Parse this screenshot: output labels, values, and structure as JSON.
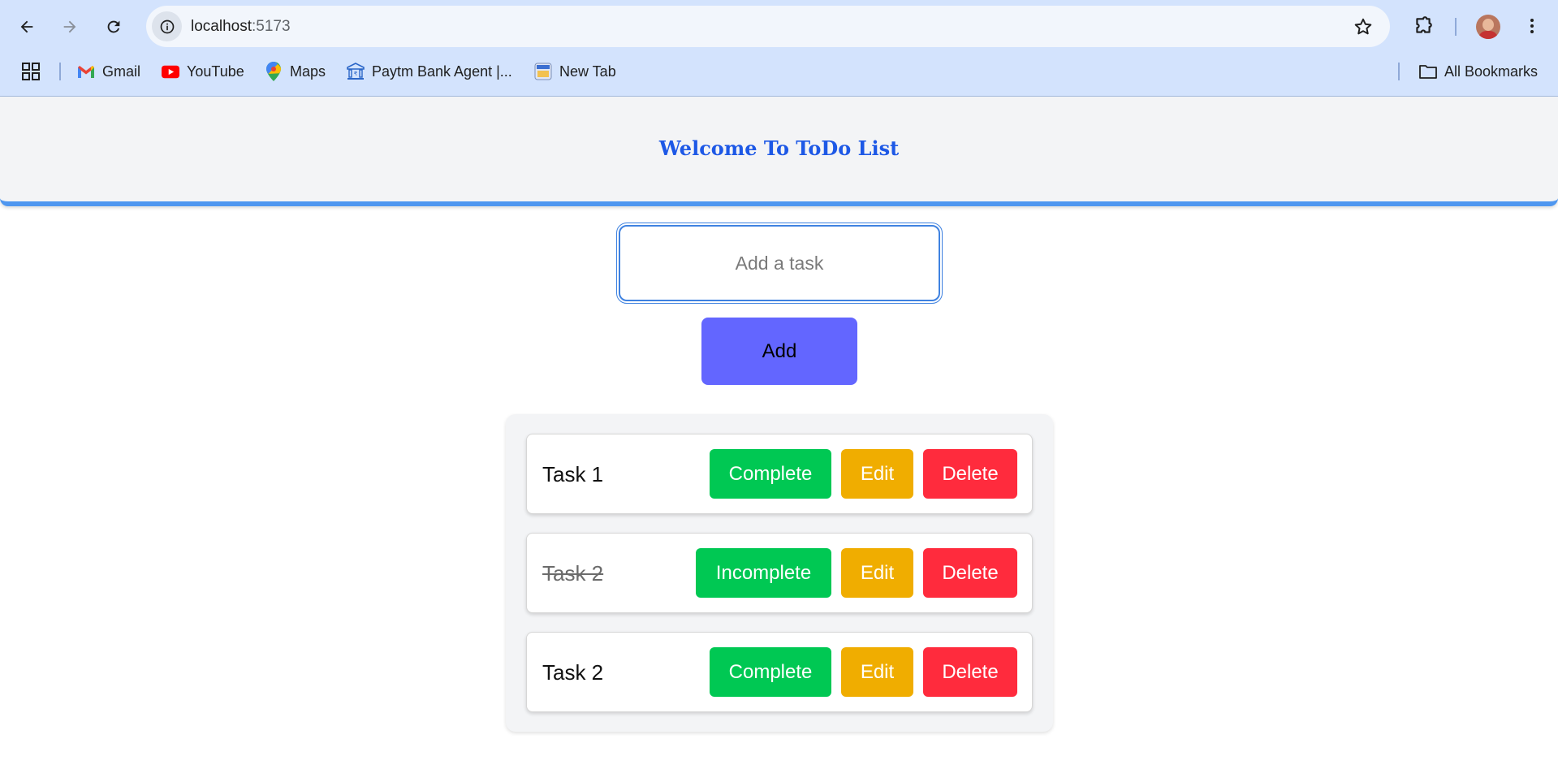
{
  "browser": {
    "url_host": "localhost",
    "url_port": ":5173",
    "bookmarks": [
      {
        "label": "Gmail",
        "icon": "gmail-icon"
      },
      {
        "label": "YouTube",
        "icon": "youtube-icon"
      },
      {
        "label": "Maps",
        "icon": "maps-icon"
      },
      {
        "label": "Paytm Bank Agent |...",
        "icon": "paytm-bank-icon"
      },
      {
        "label": "New Tab",
        "icon": "new-tab-icon"
      }
    ],
    "all_bookmarks_label": "All Bookmarks"
  },
  "page": {
    "title": "Welcome To ToDo List",
    "input_placeholder": "Add a task",
    "add_label": "Add",
    "tasks": [
      {
        "text": "Task 1",
        "completed": false,
        "toggle_label": "Complete",
        "edit_label": "Edit",
        "delete_label": "Delete"
      },
      {
        "text": "Task 2",
        "completed": true,
        "toggle_label": "Incomplete",
        "edit_label": "Edit",
        "delete_label": "Delete"
      },
      {
        "text": "Task 2",
        "completed": false,
        "toggle_label": "Complete",
        "edit_label": "Edit",
        "delete_label": "Delete"
      }
    ]
  },
  "colors": {
    "title": "#1d58e6",
    "header_border": "#4f97f0",
    "add_button": "#6366ff",
    "complete_button": "#00c853",
    "edit_button": "#f0ad00",
    "delete_button": "#ff2b3d"
  }
}
